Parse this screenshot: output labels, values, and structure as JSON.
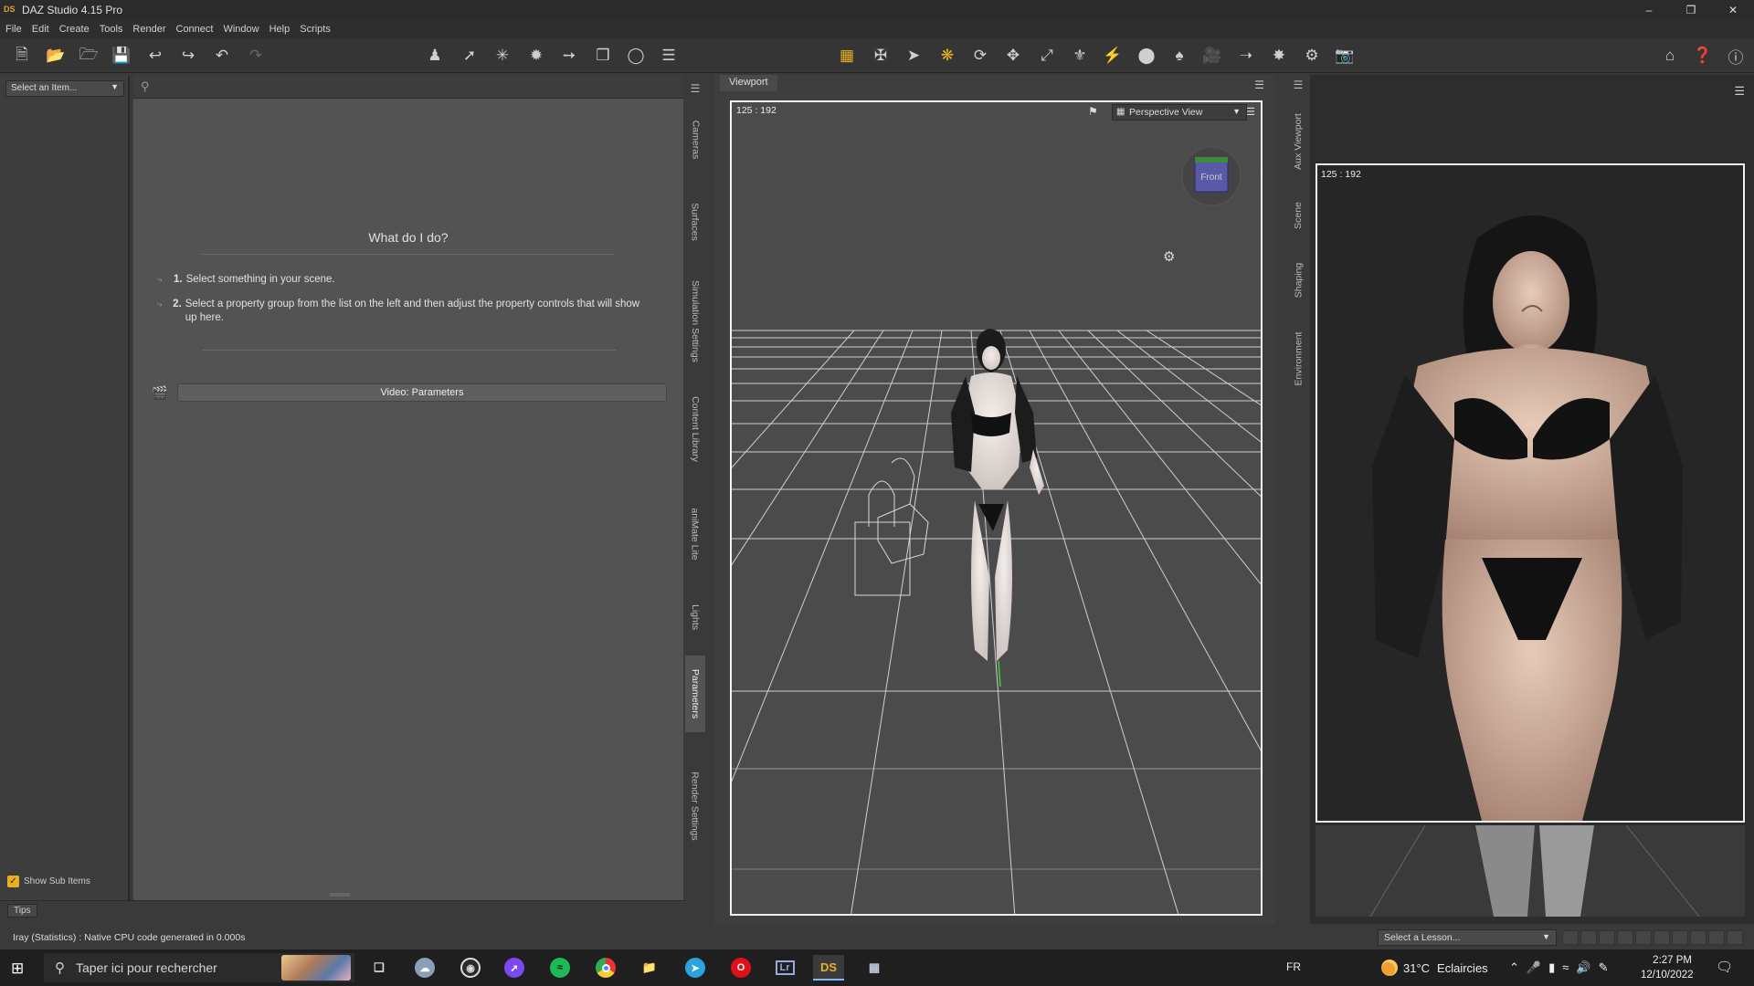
{
  "window": {
    "title": "DAZ Studio 4.15 Pro",
    "icon_text": "DS"
  },
  "menu": [
    "File",
    "Edit",
    "Create",
    "Tools",
    "Render",
    "Connect",
    "Window",
    "Help",
    "Scripts"
  ],
  "scene_selector": {
    "value": "Select an Item..."
  },
  "show_sub_items": {
    "label": "Show Sub Items",
    "checked": true
  },
  "parameters": {
    "heading": "What do I do?",
    "steps": [
      {
        "num": "1.",
        "text": "Select something in your scene."
      },
      {
        "num": "2.",
        "text": "Select a property group from the list on the left and then adjust the property controls that will show up here."
      }
    ],
    "video_button": "Video: Parameters"
  },
  "left_tabs": [
    "Cameras",
    "Surfaces",
    "Simulation Settings",
    "Content Library",
    "aniMate Lite",
    "Lights",
    "Parameters",
    "Render Settings"
  ],
  "active_left_tab": "Parameters",
  "right_tabs": [
    "Aux Viewport",
    "Scene",
    "Shaping",
    "Environment"
  ],
  "tips_tab": "Tips",
  "status_message": "Iray (Statistics) : Native CPU code generated in 0.000s",
  "lesson_select": "Select a Lesson...",
  "viewport": {
    "tab_label": "Viewport",
    "size_label": "125 : 192",
    "camera": "Perspective View",
    "navcube_face": "Front"
  },
  "aux_viewport": {
    "size_label": "125 : 192"
  },
  "taskbar": {
    "search_placeholder": "Taper ici pour rechercher",
    "lang": "FR",
    "weather_temp": "31°C",
    "weather_text": "Eclaircies",
    "time": "2:27 PM",
    "date": "12/10/2022"
  },
  "colors": {
    "accent": "#e6b020",
    "viewport_bg": "#4b4b4b",
    "panel_bg": "#535353"
  }
}
